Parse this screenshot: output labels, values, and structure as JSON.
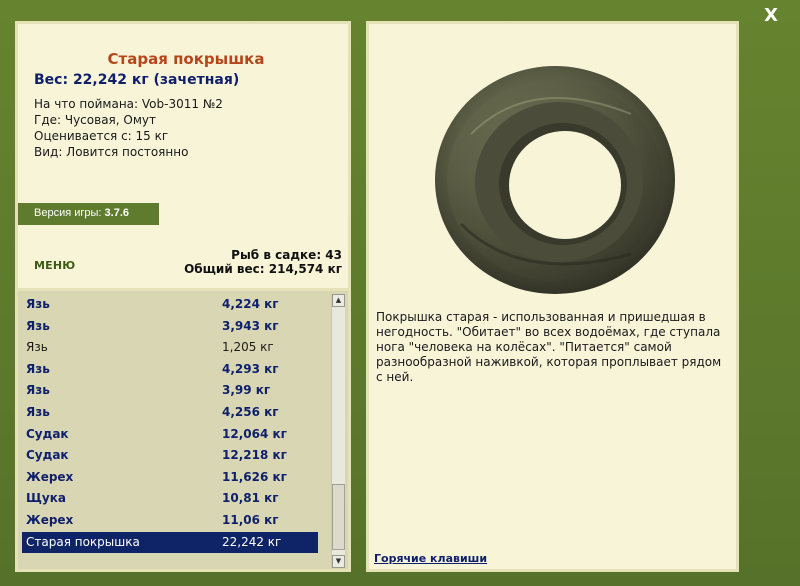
{
  "window": {
    "close_label": "X"
  },
  "catch_info": {
    "title": "Старая покрышка",
    "weight_line": "Вес: 22,242 кг (зачетная)",
    "caught_on": "На что поймана: Vob-3011 №2",
    "location": "Где: Чусовая, Омут",
    "valued_from": "Оценивается с: 15 кг",
    "kind": "Вид: Ловится постоянно"
  },
  "version": {
    "label": "Версия игры:",
    "value": "3.7.6"
  },
  "menu": {
    "label": "МЕНЮ"
  },
  "keepnet": {
    "count_line": "Рыб в садке: 43",
    "total_line": "Общий вес: 214,574 кг"
  },
  "fish_list": [
    {
      "name": "Язь",
      "weight": "4,224 кг",
      "style": "bold"
    },
    {
      "name": "Язь",
      "weight": "3,943 кг",
      "style": "bold"
    },
    {
      "name": "Язь",
      "weight": "1,205 кг",
      "style": "normal"
    },
    {
      "name": "Язь",
      "weight": "4,293 кг",
      "style": "bold"
    },
    {
      "name": "Язь",
      "weight": "3,99 кг",
      "style": "bold"
    },
    {
      "name": "Язь",
      "weight": "4,256 кг",
      "style": "bold"
    },
    {
      "name": "Судак",
      "weight": "12,064 кг",
      "style": "bold"
    },
    {
      "name": "Судак",
      "weight": "12,218 кг",
      "style": "bold"
    },
    {
      "name": "Жерех",
      "weight": "11,626 кг",
      "style": "bold"
    },
    {
      "name": "Щука",
      "weight": "10,81 кг",
      "style": "bold"
    },
    {
      "name": "Жерех",
      "weight": "11,06 кг",
      "style": "bold"
    },
    {
      "name": "Старая покрышка",
      "weight": "22,242 кг",
      "style": "selected"
    }
  ],
  "scrollbar": {
    "up_icon": "arrow-up-icon",
    "down_icon": "arrow-down-icon"
  },
  "detail": {
    "image_name": "old-tire-image",
    "description": "Покрышка старая - использованная и пришедшая в негодность. \"Обитает\" во всех водоёмах, где ступала нога \"человека на колёсах\". \"Питается\" самой разнообразной наживкой, которая проплывает рядом с ней.",
    "hotkeys_link": "Горячие клавиши"
  },
  "colors": {
    "frame_green": "#5e7b2c",
    "panel_cream": "#f7f4d8",
    "title_orange": "#b5461a",
    "navy_text": "#0f1f6b",
    "selection_navy": "#0f2467"
  }
}
